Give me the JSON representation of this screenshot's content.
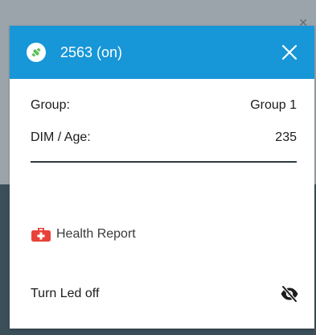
{
  "popup": {
    "title": "2563 (on)",
    "header_color": "#1796d8",
    "header_icon": "satellite-icon",
    "close_icon": "close-icon"
  },
  "details": {
    "group_label": "Group:",
    "group_value": "Group 1",
    "dim_label": "DIM / Age:",
    "dim_value": "235"
  },
  "health": {
    "icon": "medical-kit-icon",
    "icon_color": "#e8433a",
    "label": "Health Report"
  },
  "led": {
    "label": "Turn Led off",
    "icon": "eye-off-icon"
  }
}
